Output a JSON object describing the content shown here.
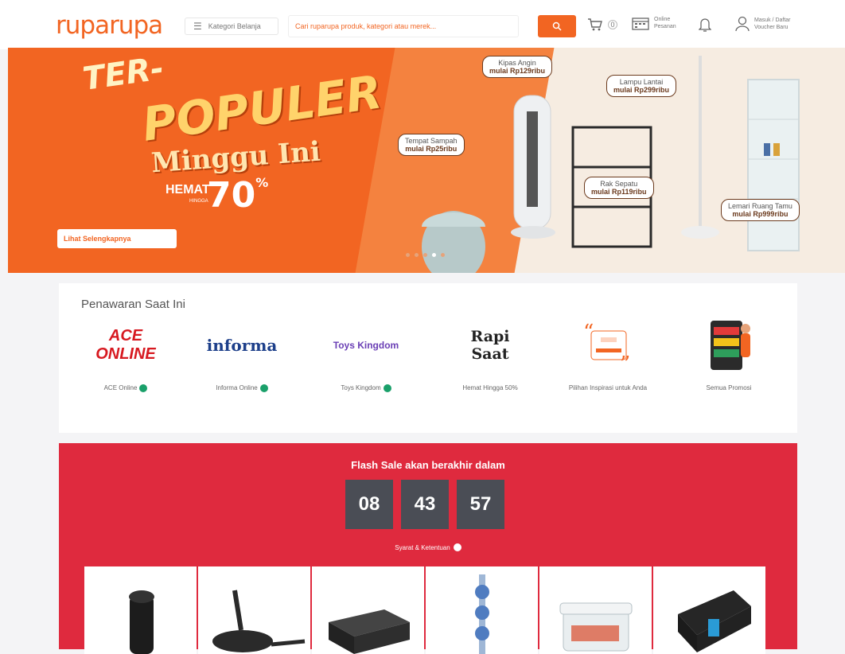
{
  "header": {
    "logo": "ruparupa",
    "category_label": "Kategori Belanja",
    "search_placeholder": "Cari ruparupa produk, kategori atau merek...",
    "cart_count": "0",
    "online_label_1": "Online",
    "online_label_2": "Pesanan",
    "user_label_1": "Masuk / Daftar",
    "user_label_2": "Voucher Baru"
  },
  "banner": {
    "title_1": "TER-",
    "title_2": "POPULER",
    "title_3": "Minggu Ini",
    "hemat": "HEMAT",
    "hingga": "HINGGA",
    "percent": "70",
    "percent_sign": "%",
    "cta": "Lihat Selengkapnya",
    "tags": [
      {
        "name": "Kipas Angin",
        "price": "mulai Rp129ribu"
      },
      {
        "name": "Lampu Lantai",
        "price": "mulai Rp299ribu"
      },
      {
        "name": "Tempat Sampah",
        "price": "mulai Rp25ribu"
      },
      {
        "name": "Rak Sepatu",
        "price": "mulai Rp119ribu"
      },
      {
        "name": "Lemari Ruang Tamu",
        "price": "mulai Rp999ribu"
      }
    ]
  },
  "offer": {
    "title": "Penawaran Saat Ini",
    "items": [
      {
        "label": "ACE Online",
        "logo": "ACE ONLINE"
      },
      {
        "label": "Informa Online",
        "logo": "informa"
      },
      {
        "label": "Toys Kingdom",
        "logo": "Toys Kingdom"
      },
      {
        "label": "Hemat Hingga 50%",
        "logo": "Rapi Saat"
      },
      {
        "label": "Pilihan Inspirasi untuk Anda",
        "logo": ""
      },
      {
        "label": "Semua Promosi",
        "logo": ""
      }
    ]
  },
  "flash": {
    "title": "Flash Sale akan berakhir dalam",
    "hours": "08",
    "minutes": "43",
    "seconds": "57",
    "terms": "Syarat & Ketentuan"
  },
  "colors": {
    "brand": "#f26522",
    "flash": "#df2a3e",
    "timer_box": "#4a4d55",
    "verified": "#1aa06a"
  }
}
